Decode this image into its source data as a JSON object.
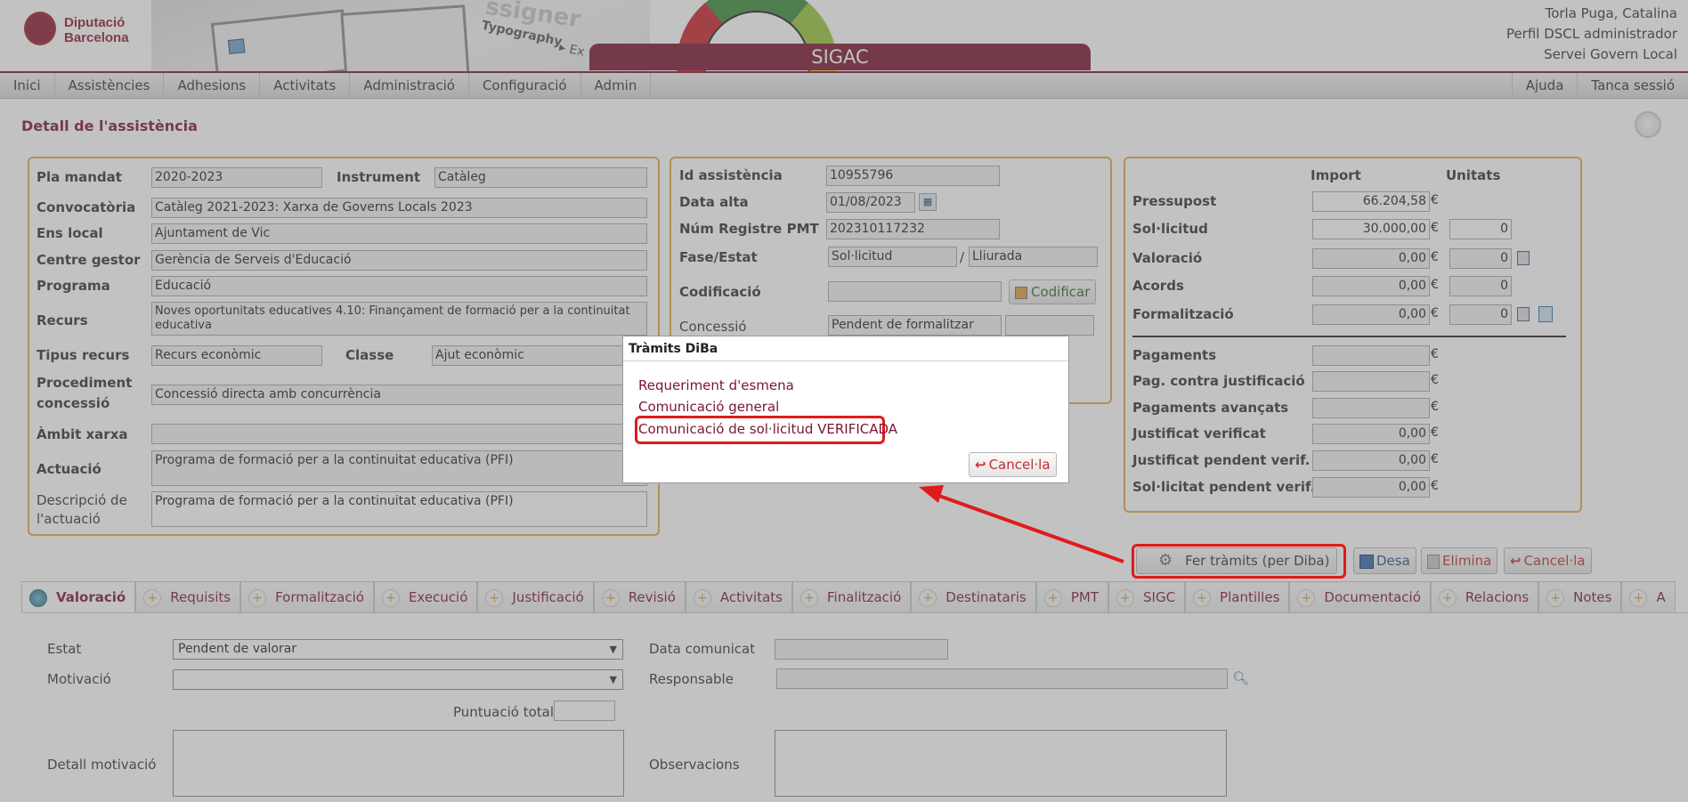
{
  "header": {
    "logo_line1": "Diputació",
    "logo_line2": "Barcelona",
    "app_title": "SIGAC",
    "user_name": "Torla Puga, Catalina",
    "user_profile": "Perfil DSCL administrador",
    "user_service": "Servei Govern Local",
    "banner_text1": "ssigner",
    "banner_text2": "Typography",
    "banner_text3": "▸ Ex"
  },
  "menu": {
    "items": [
      "Inici",
      "Assistències",
      "Adhesions",
      "Activitats",
      "Administració",
      "Configuració",
      "Admin"
    ],
    "right_items": [
      "Ajuda",
      "Tanca sessió"
    ]
  },
  "page_title": "Detall de l'assistència",
  "left_panel": {
    "pla_mandat_label": "Pla mandat",
    "pla_mandat": "2020-2023",
    "instrument_label": "Instrument",
    "instrument": "Catàleg",
    "convocatoria_label": "Convocatòria",
    "convocatoria": "Catàleg 2021-2023: Xarxa de Governs Locals 2023",
    "ens_local_label": "Ens local",
    "ens_local": "Ajuntament de Vic",
    "centre_gestor_label": "Centre gestor",
    "centre_gestor": "Gerència de Serveis d'Educació",
    "programa_label": "Programa",
    "programa": "Educació",
    "recurs_label": "Recurs",
    "recurs": "Noves oportunitats educatives 4.10: Finançament de formació per a la continuitat educativa",
    "tipus_recurs_label": "Tipus recurs",
    "tipus_recurs": "Recurs econòmic",
    "classe_label": "Classe",
    "classe": "Ajut econòmic",
    "procediment_label1": "Procediment",
    "procediment_label2": "concessió",
    "procediment": "Concessió directa amb concurrència",
    "ambit_label": "Àmbit xarxa",
    "ambit": "",
    "actuacio_label": "Actuació",
    "actuacio": "Programa de formació per a la continuitat educativa (PFI)",
    "descripcio_label1": "Descripció de",
    "descripcio_label2": "l'actuació",
    "descripcio": "Programa de formació per a la continuitat educativa (PFI)"
  },
  "mid_panel": {
    "id_label": "Id assistència",
    "id": "10955796",
    "data_alta_label": "Data alta",
    "data_alta": "01/08/2023",
    "num_registre_label": "Núm Registre PMT",
    "num_registre": "202310117232",
    "fase_label": "Fase/Estat",
    "fase": "Sol·licitud",
    "slash": "/",
    "estat": "Lliurada",
    "codificacio_label": "Codificació",
    "codificacio": "",
    "codificar_button": "Codificar",
    "concessio_label": "Concessió",
    "concessio": "Pendent de formalitzar",
    "concessio2": ""
  },
  "right_panel": {
    "col_import": "Import",
    "col_unitats": "Unitats",
    "euro": "€",
    "rows": [
      {
        "label": "Pressupost",
        "import": "66.204,58",
        "unitats": null
      },
      {
        "label": "Sol·licitud",
        "import": "30.000,00",
        "unitats": "0"
      },
      {
        "label": "Valoració",
        "import": "0,00",
        "unitats": "0"
      },
      {
        "label": "Acords",
        "import": "0,00",
        "unitats": "0"
      },
      {
        "label": "Formalització",
        "import": "0,00",
        "unitats": "0"
      },
      {
        "label": "Pagaments",
        "import": "",
        "unitats": null
      },
      {
        "label": "Pag. contra justificació",
        "import": "",
        "unitats": null
      },
      {
        "label": "Pagaments avançats",
        "import": "",
        "unitats": null
      },
      {
        "label": "Justificat verificat",
        "import": "0,00",
        "unitats": null
      },
      {
        "label": "Justificat pendent verif.",
        "import": "0,00",
        "unitats": null
      },
      {
        "label": "Sol·licitat pendent verif.",
        "import": "0,00",
        "unitats": null
      }
    ]
  },
  "actions": {
    "fer_tramits": "Fer tràmits (per Diba)",
    "desa": "Desa",
    "elimina": "Elimina",
    "cancella": "Cancel·la"
  },
  "tabs": [
    "Valoració",
    "Requisits",
    "Formalització",
    "Execució",
    "Justificació",
    "Revisió",
    "Activitats",
    "Finalització",
    "Destinataris",
    "PMT",
    "SIGC",
    "Plantilles",
    "Documentació",
    "Relacions",
    "Notes",
    "A"
  ],
  "valoracio_form": {
    "estat_label": "Estat",
    "estat": "Pendent de valorar",
    "motivacio_label": "Motivació",
    "motivacio": "",
    "puntuacio_label": "Puntuació total:",
    "puntuacio": "",
    "detall_label": "Detall motivació",
    "data_comunicat_label": "Data comunicat",
    "data_comunicat": "",
    "responsable_label": "Responsable",
    "responsable": "",
    "observacions_label": "Observacions"
  },
  "dialog": {
    "title": "Tràmits DiBa",
    "options": [
      "Requeriment d'esmena",
      "Comunicació general",
      "Comunicació de sol·licitud VERIFICADA"
    ],
    "cancel": "Cancel·la"
  },
  "colors": {
    "brand": "#7b1630",
    "highlight": "#e01b1b",
    "panel_border": "#e0a84a"
  }
}
